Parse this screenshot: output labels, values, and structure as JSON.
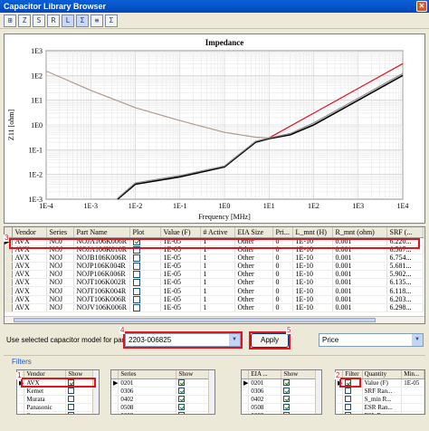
{
  "window": {
    "title": "Capacitor Library Browser"
  },
  "toolbar": {
    "buttons": [
      {
        "icon": "select-icon",
        "glyph": "⊞"
      },
      {
        "icon": "impedance-icon",
        "glyph": "Z"
      },
      {
        "icon": "s21-icon",
        "glyph": "S"
      },
      {
        "icon": "esr-icon",
        "glyph": "R"
      },
      {
        "icon": "esl-icon",
        "glyph": "L"
      },
      {
        "icon": "srf-icon",
        "glyph": "Σ"
      },
      {
        "icon": "table-icon",
        "glyph": "≡"
      },
      {
        "icon": "sum-icon",
        "glyph": "Σ"
      }
    ]
  },
  "chart_data": {
    "type": "line",
    "title": "Impedance",
    "xlabel": "Frequency [MHz]",
    "ylabel": "Z11 [ohm]",
    "x_scale": "log",
    "y_scale": "log",
    "xlim": [
      0.0001,
      10000
    ],
    "ylim": [
      0.001,
      1000
    ],
    "xticks": [
      "1E-4",
      "1E-3",
      "1E-2",
      "1E-1",
      "1E0",
      "1E1",
      "1E2",
      "1E3",
      "1E4"
    ],
    "yticks": [
      "1E3",
      "1E2",
      "1E1",
      "1E0",
      "1E-1",
      "1E-2",
      "1E-3"
    ],
    "grid": true,
    "colors": {
      "capacitive": "#b39a8c",
      "inductive": "#e3121b",
      "measured": "#000000",
      "measured2": "#8c8c8c"
    },
    "series": [
      {
        "color": "#b39a8c",
        "x": [
          0.0001,
          0.001,
          0.01,
          0.1,
          1,
          5,
          10
        ],
        "y": [
          150,
          25,
          5,
          1.5,
          0.5,
          0.32,
          0.3
        ]
      },
      {
        "color": "#e3121b",
        "x": [
          10,
          100,
          1000,
          10000
        ],
        "y": [
          0.3,
          3,
          30,
          300
        ]
      },
      {
        "color": "#000000",
        "x": [
          0.004,
          0.01,
          0.1,
          1,
          5,
          10,
          30,
          100,
          1000,
          10000
        ],
        "y": [
          0.001,
          0.004,
          0.008,
          0.02,
          0.2,
          0.28,
          0.4,
          1,
          10,
          100
        ]
      },
      {
        "color": "#8c8c8c",
        "x": [
          0.004,
          0.01,
          0.1,
          1,
          5,
          10,
          30,
          100,
          1000,
          10000
        ],
        "y": [
          0.0011,
          0.0045,
          0.009,
          0.022,
          0.22,
          0.3,
          0.45,
          1.2,
          12,
          120
        ]
      }
    ]
  },
  "table": {
    "columns": [
      "Vendor",
      "Series",
      "Part Name",
      "Plot",
      "Value (F)",
      "# Active",
      "EIA Size",
      "Pri...",
      "L_mnt (H)",
      "R_mnt (ohm)",
      "SRF (..."
    ],
    "rows": [
      {
        "vendor": "AVX",
        "series": "NOJ",
        "part": "NOJA106K006R",
        "plot": true,
        "value": "1E-05",
        "active": "1",
        "eia": "Other",
        "pri": "0",
        "lmnt": "1E-10",
        "rmnt": "0.001",
        "srf": "6.220..."
      },
      {
        "vendor": "AVX",
        "series": "NOJ",
        "part": "NOJA106K010R",
        "plot": false,
        "value": "1E-05",
        "active": "1",
        "eia": "Other",
        "pri": "0",
        "lmnt": "1E-10",
        "rmnt": "0.001",
        "srf": "6.507..."
      },
      {
        "vendor": "AVX",
        "series": "NOJ",
        "part": "NOJB106K006R",
        "plot": false,
        "value": "1E-05",
        "active": "1",
        "eia": "Other",
        "pri": "0",
        "lmnt": "1E-10",
        "rmnt": "0.001",
        "srf": "6.754..."
      },
      {
        "vendor": "AVX",
        "series": "NOJ",
        "part": "NOJP106K004R",
        "plot": false,
        "value": "1E-05",
        "active": "1",
        "eia": "Other",
        "pri": "0",
        "lmnt": "1E-10",
        "rmnt": "0.001",
        "srf": "5.681..."
      },
      {
        "vendor": "AVX",
        "series": "NOJ",
        "part": "NOJP106K006R",
        "plot": false,
        "value": "1E-05",
        "active": "1",
        "eia": "Other",
        "pri": "0",
        "lmnt": "1E-10",
        "rmnt": "0.001",
        "srf": "5.902..."
      },
      {
        "vendor": "AVX",
        "series": "NOJ",
        "part": "NOJT106K002R",
        "plot": false,
        "value": "1E-05",
        "active": "1",
        "eia": "Other",
        "pri": "0",
        "lmnt": "1E-10",
        "rmnt": "0.001",
        "srf": "6.135..."
      },
      {
        "vendor": "AVX",
        "series": "NOJ",
        "part": "NOJT106K004R",
        "plot": false,
        "value": "1E-05",
        "active": "1",
        "eia": "Other",
        "pri": "0",
        "lmnt": "1E-10",
        "rmnt": "0.001",
        "srf": "6.118..."
      },
      {
        "vendor": "AVX",
        "series": "NOJ",
        "part": "NOJT106K006R",
        "plot": false,
        "value": "1E-05",
        "active": "1",
        "eia": "Other",
        "pri": "0",
        "lmnt": "1E-10",
        "rmnt": "0.001",
        "srf": "6.203..."
      },
      {
        "vendor": "AVX",
        "series": "NOJ",
        "part": "NOJV106K006R",
        "plot": false,
        "value": "1E-05",
        "active": "1",
        "eia": "Other",
        "pri": "0",
        "lmnt": "1E-10",
        "rmnt": "0.001",
        "srf": "6.298..."
      }
    ]
  },
  "model": {
    "label": "Use selected capacitor model for part:",
    "part_value": "2203-006825",
    "apply_label": "Apply",
    "sort_value": "Price"
  },
  "callouts": [
    "1",
    "2",
    "3",
    "4",
    "5"
  ],
  "filters": {
    "title": "Filters",
    "vendor": {
      "columns": [
        "Vendor",
        "Show"
      ],
      "rows": [
        {
          "name": "AVX",
          "show": true
        },
        {
          "name": "Kemet",
          "show": false
        },
        {
          "name": "Murata",
          "show": false
        },
        {
          "name": "Panasonic",
          "show": false
        },
        {
          "name": "Samsung",
          "show": false
        }
      ]
    },
    "series": {
      "columns": [
        "Series",
        "Show"
      ],
      "rows": [
        {
          "name": "0201",
          "show": true
        },
        {
          "name": "0306",
          "show": true
        },
        {
          "name": "0402",
          "show": true
        },
        {
          "name": "0508",
          "show": true
        },
        {
          "name": "0603",
          "show": true
        }
      ]
    },
    "eia": {
      "columns": [
        "EIA ...",
        "Show"
      ],
      "rows": [
        {
          "name": "0201",
          "show": true
        },
        {
          "name": "0306",
          "show": true
        },
        {
          "name": "0402",
          "show": true
        },
        {
          "name": "0508",
          "show": true
        },
        {
          "name": "0603",
          "show": true
        }
      ]
    },
    "quantity": {
      "columns": [
        "Filter",
        "Quantity",
        "Min..."
      ],
      "rows": [
        {
          "filter": true,
          "name": "Value (F)",
          "min": "1E-05"
        },
        {
          "filter": false,
          "name": "SRF Ran...",
          "min": ""
        },
        {
          "filter": false,
          "name": "S_min R...",
          "min": ""
        },
        {
          "filter": false,
          "name": "ESR Ran...",
          "min": ""
        },
        {
          "filter": false,
          "name": "ESL Ran...",
          "min": ""
        }
      ]
    }
  }
}
